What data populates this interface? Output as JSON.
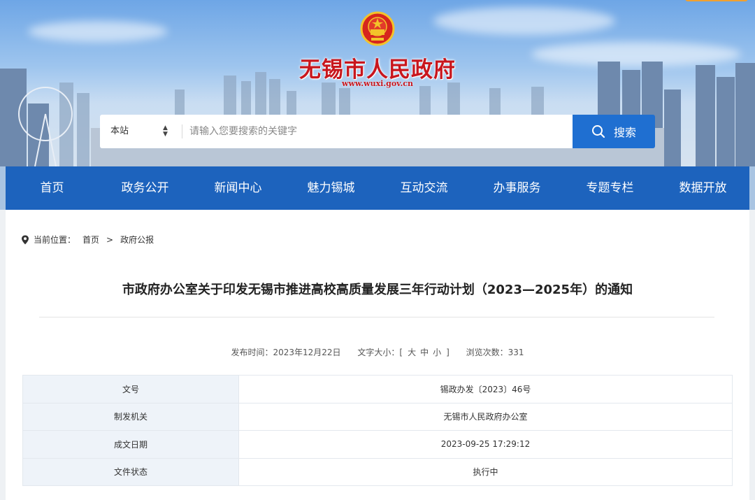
{
  "header": {
    "site_title": "无锡市人民政府",
    "site_url": "www.wuxi.gov.cn"
  },
  "search": {
    "scope": "本站",
    "placeholder": "请输入您要搜索的关键字",
    "button_label": "搜索"
  },
  "nav": {
    "items": [
      "首页",
      "政务公开",
      "新闻中心",
      "魅力锡城",
      "互动交流",
      "办事服务",
      "专题专栏",
      "数据开放"
    ]
  },
  "breadcrumb": {
    "label": "当前位置：",
    "items": [
      "首页",
      "政府公报"
    ],
    "separator": ">"
  },
  "article": {
    "title": "市政府办公室关于印发无锡市推进高校高质量发展三年行动计划（2023—2025年）的通知",
    "meta": {
      "publish_label": "发布时间：",
      "publish_date": "2023年12月22日",
      "font_label": "文字大小：",
      "bracket_open": "[",
      "font_sizes": [
        "大",
        "中",
        "小"
      ],
      "bracket_close": "]",
      "views_label": "浏览次数：",
      "views": "331"
    }
  },
  "info_table": [
    {
      "key": "文号",
      "value": "锡政办发〔2023〕46号"
    },
    {
      "key": "制发机关",
      "value": "无锡市人民政府办公室"
    },
    {
      "key": "成文日期",
      "value": "2023-09-25 17:29:12"
    },
    {
      "key": "文件状态",
      "value": "执行中"
    }
  ],
  "colors": {
    "nav_blue": "#1d63bd",
    "search_button": "#1f6fd1",
    "title_red": "#c8161d"
  },
  "icons": [
    "national-emblem-icon",
    "sort-arrows-icon",
    "search-icon",
    "location-pin-icon"
  ]
}
